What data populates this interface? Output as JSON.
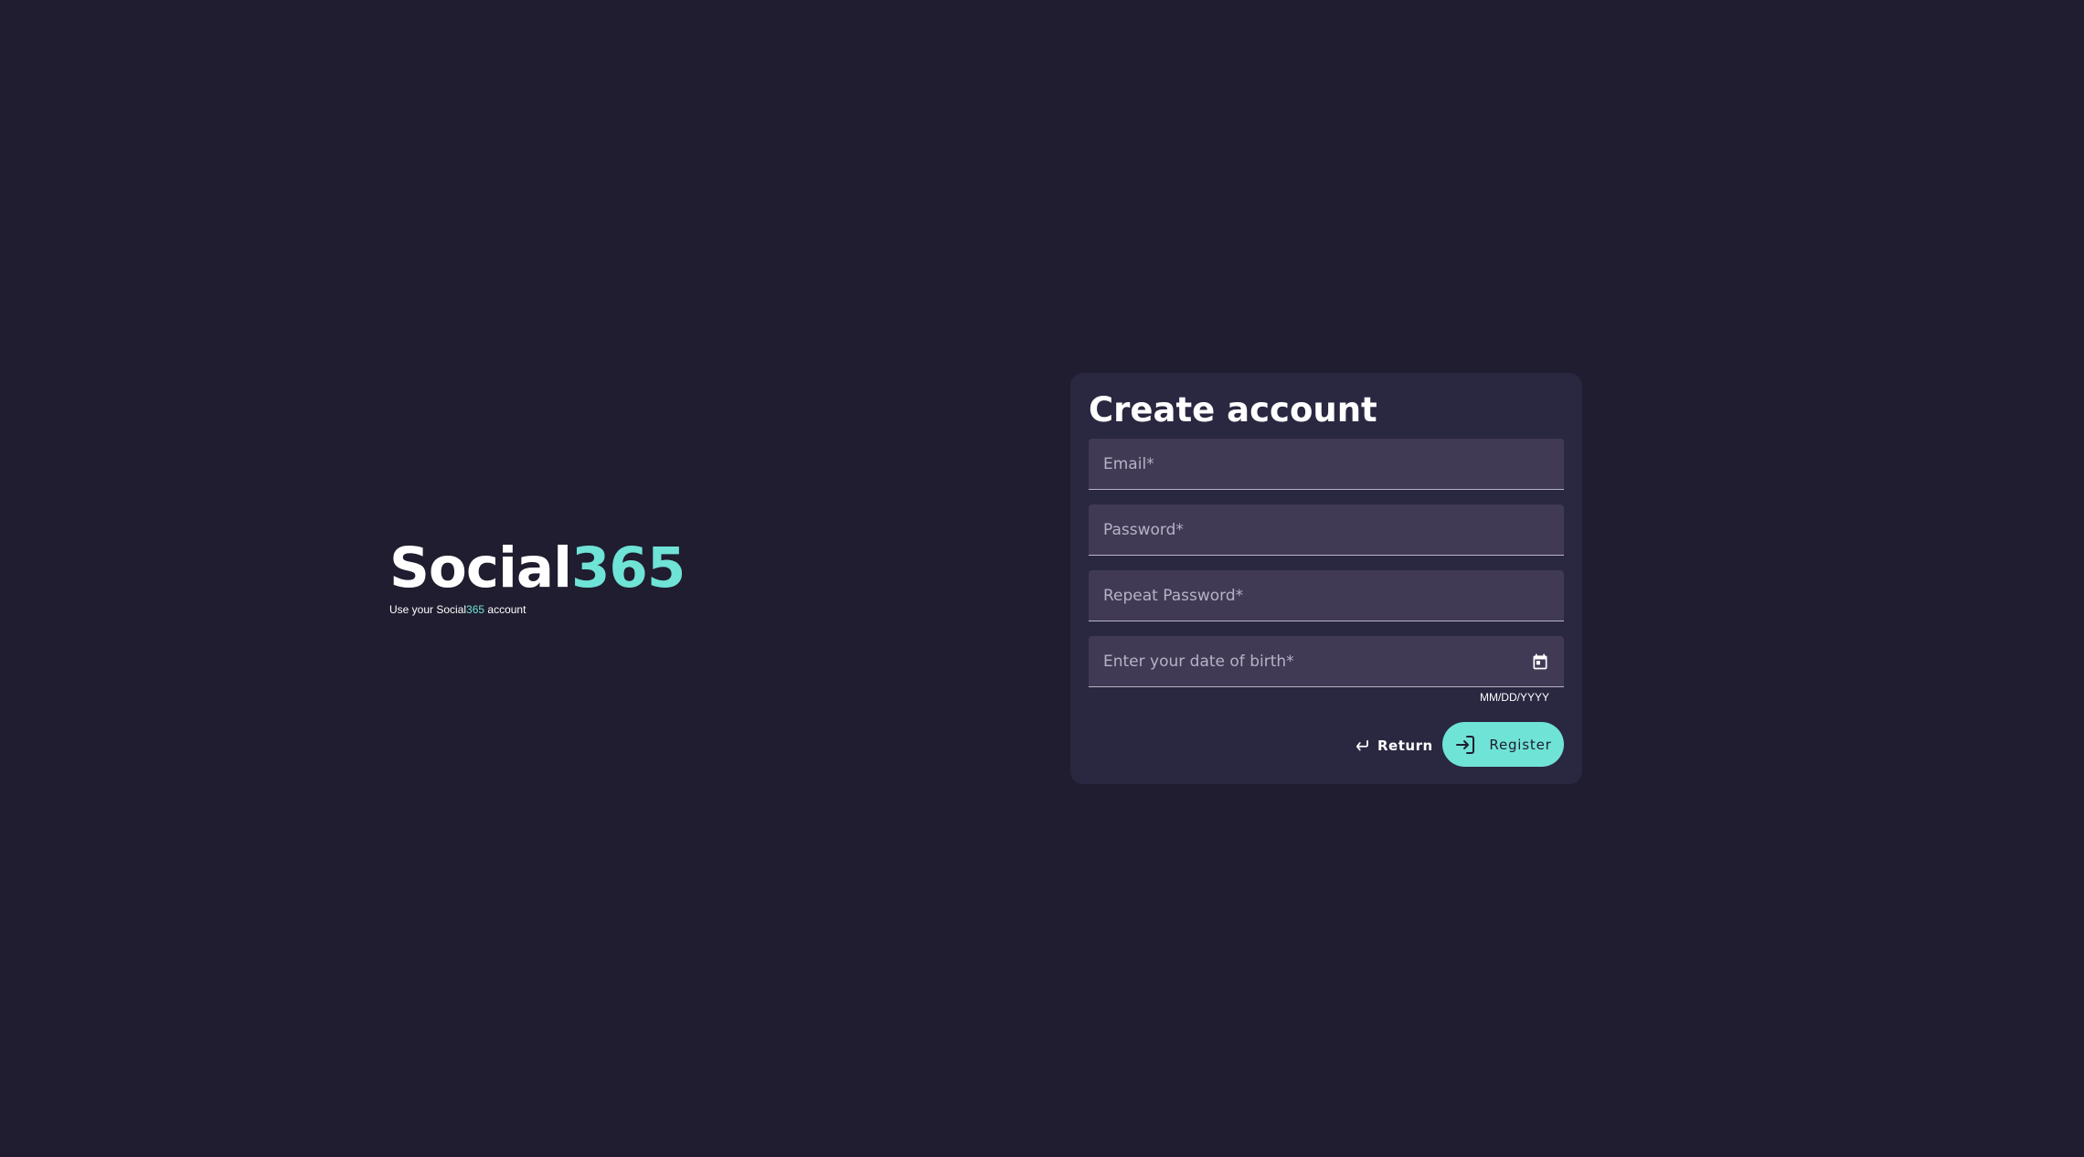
{
  "brand": {
    "logo_primary": "Social",
    "logo_accent": "365",
    "subtitle_prefix": "Use your Social",
    "subtitle_accent": "365",
    "subtitle_suffix": " account"
  },
  "form": {
    "title": "Create account",
    "email_placeholder": "Email*",
    "password_placeholder": "Password*",
    "repeat_password_placeholder": "Repeat Password*",
    "dob_placeholder": "Enter your date of birth*",
    "dob_hint": "MM/DD/YYYY",
    "dob_icon": "calendar-icon"
  },
  "actions": {
    "return_label": "Return",
    "return_icon": "return-arrow-icon",
    "register_label": "Register",
    "register_icon": "login-icon"
  },
  "colors": {
    "background": "#1f1d2f",
    "card": "#2a2741",
    "field": "#413a55",
    "accent": "#6fe3d6"
  }
}
